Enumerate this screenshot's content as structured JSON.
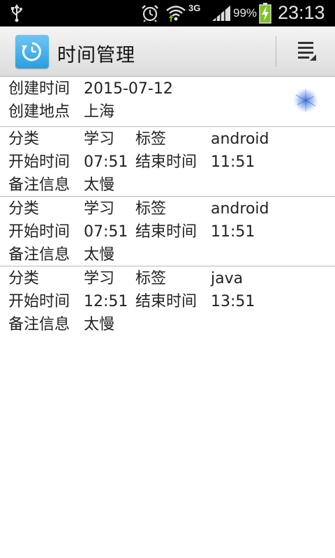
{
  "status_bar": {
    "network_type": "3G",
    "battery_percent": "99%",
    "time": "23:13",
    "icons": [
      "usb-icon",
      "alarm-icon",
      "wifi-icon",
      "signal-icon",
      "battery-charging-icon"
    ]
  },
  "action_bar": {
    "title": "时间管理",
    "app_icon": "clock-history-icon",
    "menu_icon": "overflow-menu-icon"
  },
  "header": {
    "created_time_label": "创建时间",
    "created_time_value": "2015-07-12",
    "created_place_label": "创建地点",
    "created_place_value": "上海"
  },
  "labels": {
    "category": "分类",
    "tag": "标签",
    "start_time": "开始时间",
    "end_time": "结束时间",
    "note": "备注信息"
  },
  "records": [
    {
      "category": "学习",
      "tag": "android",
      "start": "07:51",
      "end": "11:51",
      "note": "太慢"
    },
    {
      "category": "学习",
      "tag": "android",
      "start": "07:51",
      "end": "11:51",
      "note": "太慢"
    },
    {
      "category": "学习",
      "tag": "java",
      "start": "12:51",
      "end": "13:51",
      "note": "太慢"
    }
  ],
  "colors": {
    "status_bar_bg": "#000000",
    "action_bar_bg": "#e8e8e8",
    "app_icon_blue": "#2a9fe0",
    "battery_green": "#7dc21e",
    "divider": "#b8b8b8",
    "text": "#222222"
  }
}
